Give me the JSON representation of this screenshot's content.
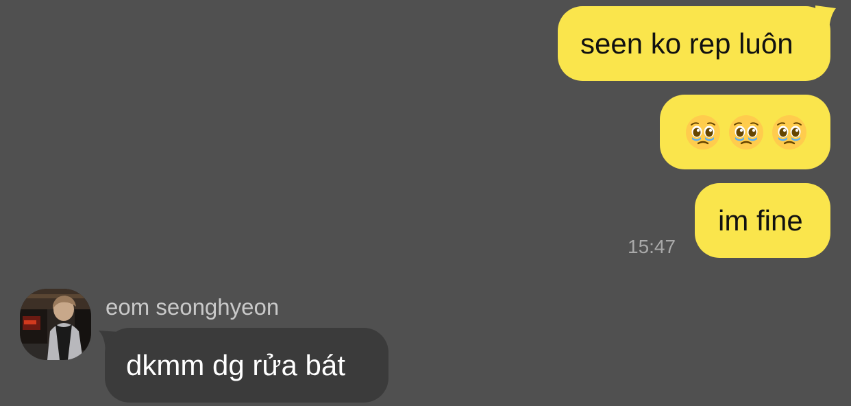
{
  "colors": {
    "background": "#505050",
    "outgoing_bubble": "#fae54c",
    "incoming_bubble": "#3b3b3b",
    "timestamp": "#a9a9a9",
    "sender_name": "#c9c9c9"
  },
  "messages": {
    "outgoing": [
      {
        "text": "seen ko rep luôn"
      },
      {
        "emoji_icons": [
          "pleading-face-emoji",
          "pleading-face-emoji",
          "pleading-face-emoji"
        ]
      },
      {
        "text": "im fine"
      }
    ],
    "outgoing_time": "15:47",
    "incoming": {
      "sender_name": "eom seonghyeon",
      "avatar_icon": "profile-photo",
      "text": "dkmm dg rửa bát"
    }
  }
}
